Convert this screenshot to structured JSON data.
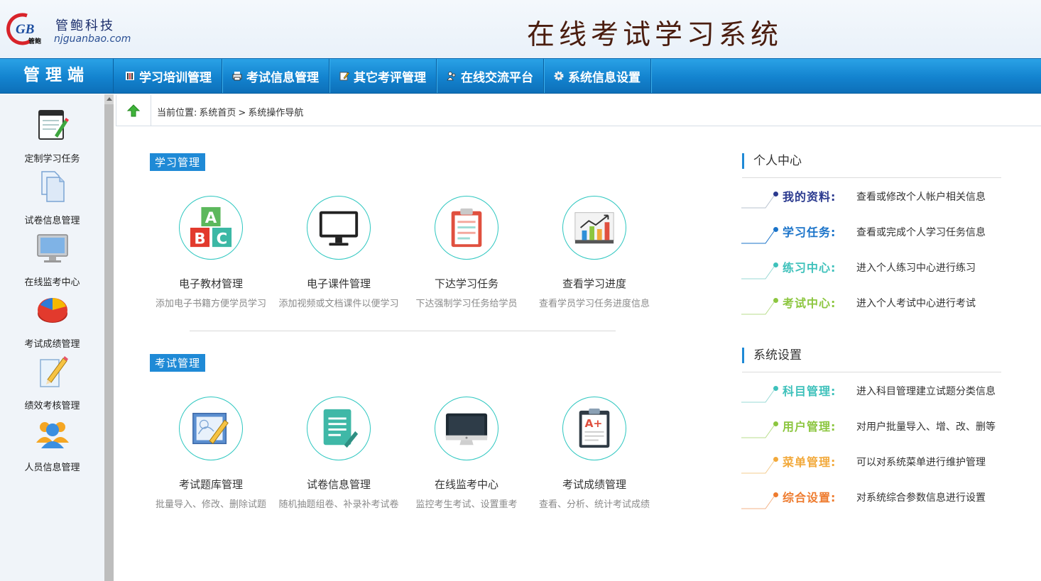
{
  "header": {
    "logo_letters": "GB",
    "logo_sub": "管鲍",
    "company_cn": "管鲍科技",
    "company_url": "njguanbao.com",
    "system_title": "在线考试学习系统"
  },
  "nav": {
    "admin_label": "管理端",
    "items": [
      {
        "label": "学习培训管理",
        "icon": "book-icon"
      },
      {
        "label": "考试信息管理",
        "icon": "printer-icon"
      },
      {
        "label": "其它考评管理",
        "icon": "edit-icon"
      },
      {
        "label": "在线交流平台",
        "icon": "people-icon"
      },
      {
        "label": "系统信息设置",
        "icon": "gear-icon"
      }
    ]
  },
  "sidebar": {
    "items": [
      {
        "label": "定制学习任务",
        "icon": "notepad-pencil-icon"
      },
      {
        "label": "试卷信息管理",
        "icon": "documents-icon"
      },
      {
        "label": "在线监考中心",
        "icon": "monitor-icon"
      },
      {
        "label": "考试成绩管理",
        "icon": "pie-chart-icon"
      },
      {
        "label": "绩效考核管理",
        "icon": "pencil-paper-icon"
      },
      {
        "label": "人员信息管理",
        "icon": "users-icon"
      }
    ]
  },
  "breadcrumb": {
    "prefix": "当前位置:",
    "home": "系统首页",
    "sep": ">",
    "current": "系统操作导航"
  },
  "study": {
    "tag": "学习管理",
    "tiles": [
      {
        "name": "电子教材管理",
        "desc": "添加电子书籍方便学员学习",
        "icon": "abc-blocks-icon"
      },
      {
        "name": "电子课件管理",
        "desc": "添加视频或文档课件以便学习",
        "icon": "monitor-icon"
      },
      {
        "name": "下达学习任务",
        "desc": "下达强制学习任务给学员",
        "icon": "clipboard-icon"
      },
      {
        "name": "查看学习进度",
        "desc": "查看学员学习任务进度信息",
        "icon": "bar-chart-icon"
      }
    ]
  },
  "exam": {
    "tag": "考试管理",
    "tiles": [
      {
        "name": "考试题库管理",
        "desc": "批量导入、修改、删除试题",
        "icon": "drawing-icon"
      },
      {
        "name": "试卷信息管理",
        "desc": "随机抽题组卷、补录补考试卷",
        "icon": "document-edit-icon"
      },
      {
        "name": "在线监考中心",
        "desc": "监控考生考试、设置重考",
        "icon": "imac-icon"
      },
      {
        "name": "考试成绩管理",
        "desc": "查看、分析、统计考试成绩",
        "icon": "grade-clipboard-icon"
      }
    ]
  },
  "personal": {
    "title": "个人中心",
    "rows": [
      {
        "key": "我的资料:",
        "val": "查看或修改个人帐户相关信息",
        "color": "#2b3a8f"
      },
      {
        "key": "学习任务:",
        "val": "查看或完成个人学习任务信息",
        "color": "#1a73c9"
      },
      {
        "key": "练习中心:",
        "val": "进入个人练习中心进行练习",
        "color": "#3ec1bb"
      },
      {
        "key": "考试中心:",
        "val": "进入个人考试中心进行考试",
        "color": "#8cc63f"
      }
    ]
  },
  "settings": {
    "title": "系统设置",
    "rows": [
      {
        "key": "科目管理:",
        "val": "进入科目管理建立试题分类信息",
        "color": "#3ec1bb"
      },
      {
        "key": "用户管理:",
        "val": "对用户批量导入、增、改、删等",
        "color": "#8cc63f"
      },
      {
        "key": "菜单管理:",
        "val": "可以对系统菜单进行维护管理",
        "color": "#f2a93b"
      },
      {
        "key": "综合设置:",
        "val": "对系统综合参数信息进行设置",
        "color": "#ee7b2e"
      }
    ]
  }
}
